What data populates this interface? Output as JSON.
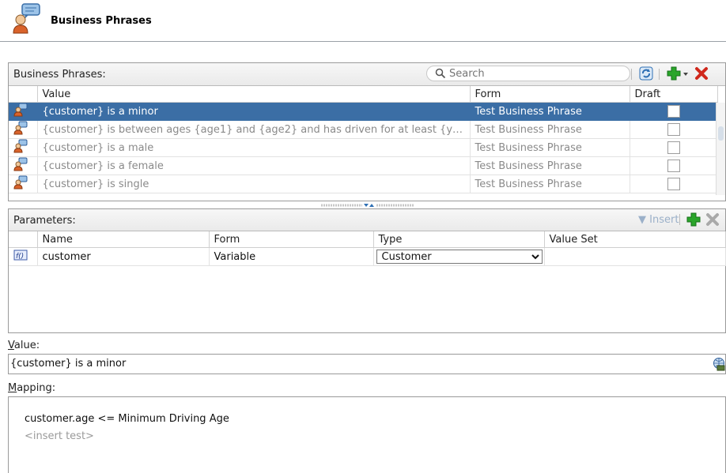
{
  "header": {
    "title": "Business Phrases",
    "icon": "business-phrase-person-icon"
  },
  "phrases_panel": {
    "title": "Business Phrases:",
    "search_placeholder": "Search",
    "toolbar_icons": [
      "refresh-icon",
      "add-icon",
      "dropdown-arrow-icon",
      "delete-icon"
    ],
    "columns": [
      "Value",
      "Form",
      "Draft"
    ],
    "rows": [
      {
        "value": "{customer} is a minor",
        "form": "Test Business Phrase",
        "draft": false,
        "selected": true
      },
      {
        "value": "{customer} is between ages {age1} and {age2} and has driven for at least {ye...",
        "form": "Test Business Phrase",
        "draft": false,
        "selected": false
      },
      {
        "value": "{customer} is a male",
        "form": "Test Business Phrase",
        "draft": false,
        "selected": false
      },
      {
        "value": "{customer} is a female",
        "form": "Test Business Phrase",
        "draft": false,
        "selected": false
      },
      {
        "value": "{customer} is single",
        "form": "Test Business Phrase",
        "draft": false,
        "selected": false
      }
    ]
  },
  "parameters_panel": {
    "title": "Parameters:",
    "insert_label": "Insert",
    "columns": [
      "Name",
      "Form",
      "Type",
      "Value Set"
    ],
    "rows": [
      {
        "name": "customer",
        "form": "Variable",
        "type": "Customer",
        "value_set": ""
      }
    ]
  },
  "value_section": {
    "label_underlined": "V",
    "label_rest": "alue:",
    "value": "{customer} is a minor"
  },
  "mapping_section": {
    "label_underlined": "M",
    "label_rest": "apping:",
    "expression": "customer.age  <=  Minimum Driving Age",
    "placeholder": "<insert test>"
  },
  "colors": {
    "selection": "#3b6ea5",
    "add_green": "#2aa52a",
    "delete_red": "#d0281c"
  }
}
